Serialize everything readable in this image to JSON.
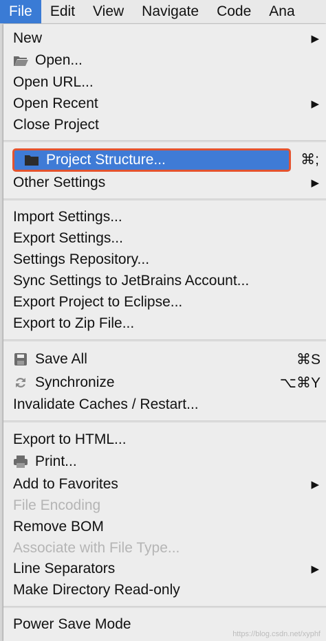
{
  "menubar": {
    "items": [
      "File",
      "Edit",
      "View",
      "Navigate",
      "Code",
      "Ana"
    ]
  },
  "menu": {
    "new": "New",
    "open": "Open...",
    "open_url": "Open URL...",
    "open_recent": "Open Recent",
    "close_project": "Close Project",
    "project_structure": "Project Structure...",
    "project_structure_shortcut": "⌘;",
    "other_settings": "Other Settings",
    "import_settings": "Import Settings...",
    "export_settings": "Export Settings...",
    "settings_repository": "Settings Repository...",
    "sync_settings": "Sync Settings to JetBrains Account...",
    "export_eclipse": "Export Project to Eclipse...",
    "export_zip": "Export to Zip File...",
    "save_all": "Save All",
    "save_all_shortcut": "⌘S",
    "synchronize": "Synchronize",
    "synchronize_shortcut": "⌥⌘Y",
    "invalidate_caches": "Invalidate Caches / Restart...",
    "export_html": "Export to HTML...",
    "print": "Print...",
    "add_favorites": "Add to Favorites",
    "file_encoding": "File Encoding",
    "remove_bom": "Remove BOM",
    "associate_file_type": "Associate with File Type...",
    "line_separators": "Line Separators",
    "make_readonly": "Make Directory Read-only",
    "power_save": "Power Save Mode",
    "submenu_arrow": "▶"
  },
  "watermark": "https://blog.csdn.net/xyphf",
  "colors": {
    "highlight": "#3f7bd6",
    "highlight_border": "#e4532e",
    "menubar_active": "#3a7bd5",
    "disabled_text": "#b5b5b5"
  }
}
